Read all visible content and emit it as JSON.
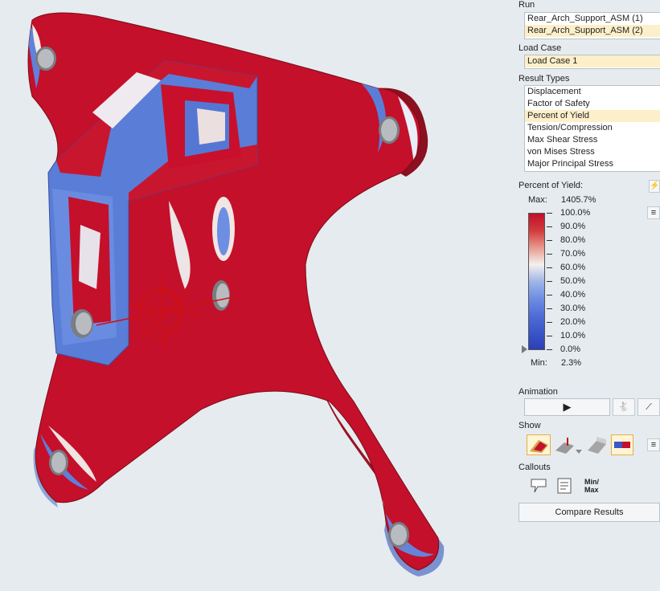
{
  "run": {
    "title": "Run",
    "items": [
      {
        "label": "Rear_Arch_Support_ASM (1)",
        "selected": false
      },
      {
        "label": "Rear_Arch_Support_ASM (2)",
        "selected": true
      }
    ]
  },
  "load_case": {
    "title": "Load Case",
    "items": [
      {
        "label": "Load Case 1",
        "selected": true
      }
    ]
  },
  "result_types": {
    "title": "Result Types",
    "items": [
      {
        "label": "Displacement",
        "selected": false
      },
      {
        "label": "Factor of Safety",
        "selected": false
      },
      {
        "label": "Percent of Yield",
        "selected": true
      },
      {
        "label": "Tension/Compression",
        "selected": false
      },
      {
        "label": "Max Shear Stress",
        "selected": false
      },
      {
        "label": "von Mises Stress",
        "selected": false
      },
      {
        "label": "Major Principal Stress",
        "selected": false
      }
    ]
  },
  "scale": {
    "title": "Percent of Yield:",
    "max_label": "Max:",
    "max_value": "1405.7%",
    "min_label": "Min:",
    "min_value": "2.3%",
    "ticks": [
      "100.0%",
      "90.0%",
      "80.0%",
      "70.0%",
      "60.0%",
      "50.0%",
      "40.0%",
      "30.0%",
      "20.0%",
      "10.0%",
      "0.0%"
    ],
    "colors": [
      "#c0102a",
      "#d23a3c",
      "#e8988c",
      "#f4f0ee",
      "#9fb6e6",
      "#6d8ee2",
      "#4f6dd6",
      "#3a56c8",
      "#2b40b4"
    ]
  },
  "animation": {
    "title": "Animation",
    "play_icon": "play-icon",
    "speed_icon": "rabbit-icon",
    "curve_icon": "curve-icon"
  },
  "show": {
    "title": "Show",
    "icons": [
      "deformed-shape-icon",
      "loads-icon",
      "undeformed-icon",
      "legend-icon"
    ],
    "menu_icon": "menu-icon"
  },
  "callouts": {
    "title": "Callouts",
    "minmax_label_1": "Min/",
    "minmax_label_2": "Max",
    "icons": [
      "callout-icon",
      "note-icon"
    ]
  },
  "compare_label": "Compare Results"
}
